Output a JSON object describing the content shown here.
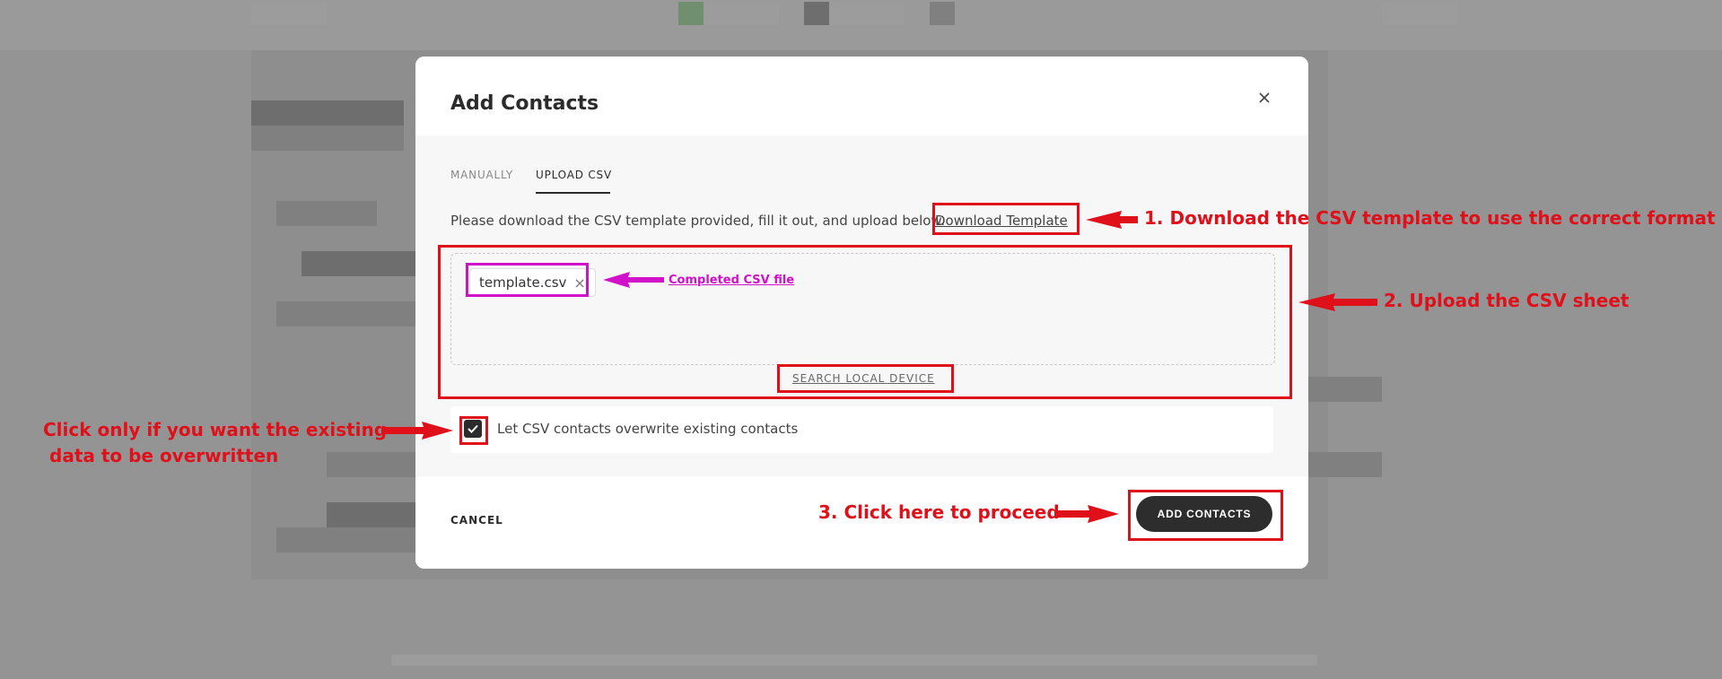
{
  "modal": {
    "title": "Add Contacts",
    "close_icon": "close-icon"
  },
  "tabs": [
    {
      "label": "MANUALLY",
      "active": false
    },
    {
      "label": "UPLOAD CSV",
      "active": true
    }
  ],
  "upload": {
    "instructions": "Please download the CSV template provided, fill it out, and upload below.",
    "download_link": "Download Template",
    "file_name": "template.csv",
    "search_link": "SEARCH LOCAL DEVICE"
  },
  "overwrite": {
    "label": "Let CSV contacts overwrite existing contacts",
    "checked": true
  },
  "footer": {
    "cancel_label": "CANCEL",
    "add_label": "ADD CONTACTS"
  },
  "annotations": {
    "step1": "1. Download the CSV template to use the correct format",
    "step2": "2. Upload the CSV sheet",
    "step3": "3. Click here to proceed",
    "completed_file": "Completed CSV file",
    "overwrite_line1": "Click only if you want the existing",
    "overwrite_line2": "data to be overwritten"
  },
  "colors": {
    "annotation_red": "#e0101a",
    "annotation_pink": "#d111c9",
    "primary_button": "#2d2d2d"
  }
}
